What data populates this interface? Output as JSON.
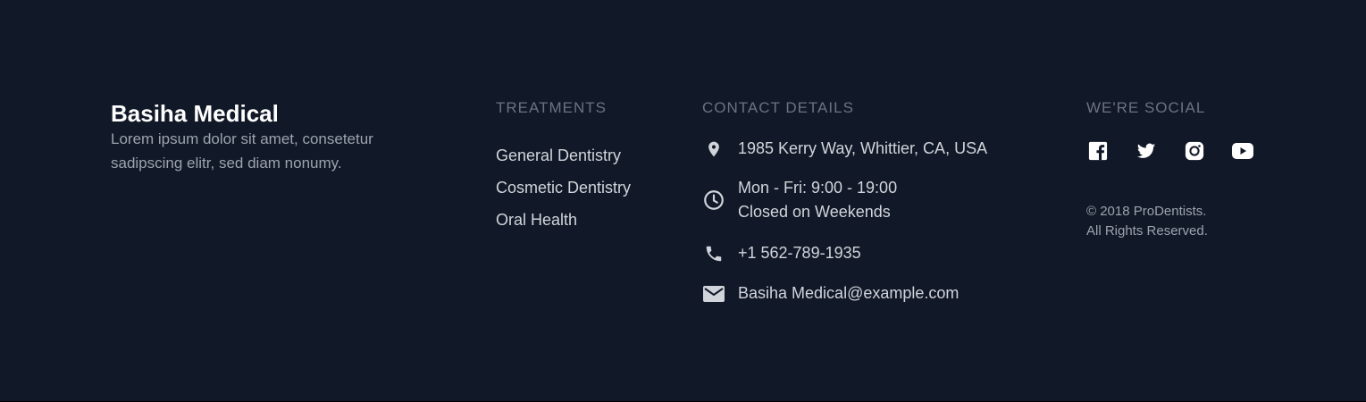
{
  "brand": {
    "name": "Basiha Medical",
    "description": "Lorem ipsum dolor sit amet, consetetur sadipscing elitr, sed diam nonumy."
  },
  "treatments": {
    "heading": "TREATMENTS",
    "items": [
      "General Dentistry",
      "Cosmetic Dentistry",
      "Oral Health"
    ]
  },
  "contact": {
    "heading": "CONTACT DETAILS",
    "address": "1985 Kerry Way, Whittier, CA, USA",
    "hours_line1": "Mon - Fri: 9:00 - 19:00",
    "hours_line2": "Closed on Weekends",
    "phone": "+1 562-789-1935",
    "email": "Basiha Medical@example.com",
    "icons": [
      "location-pin-icon",
      "clock-icon",
      "phone-icon",
      "mail-icon"
    ]
  },
  "social": {
    "heading": "WE'RE SOCIAL",
    "icons": [
      "facebook-icon",
      "twitter-icon",
      "instagram-icon",
      "youtube-icon"
    ],
    "copyright_line1": "© 2018 ProDentists.",
    "copyright_line2": "All Rights Reserved."
  },
  "colors": {
    "background": "#111827",
    "heading": "#6b7280",
    "text": "#d1d5db",
    "brand": "#ffffff"
  }
}
